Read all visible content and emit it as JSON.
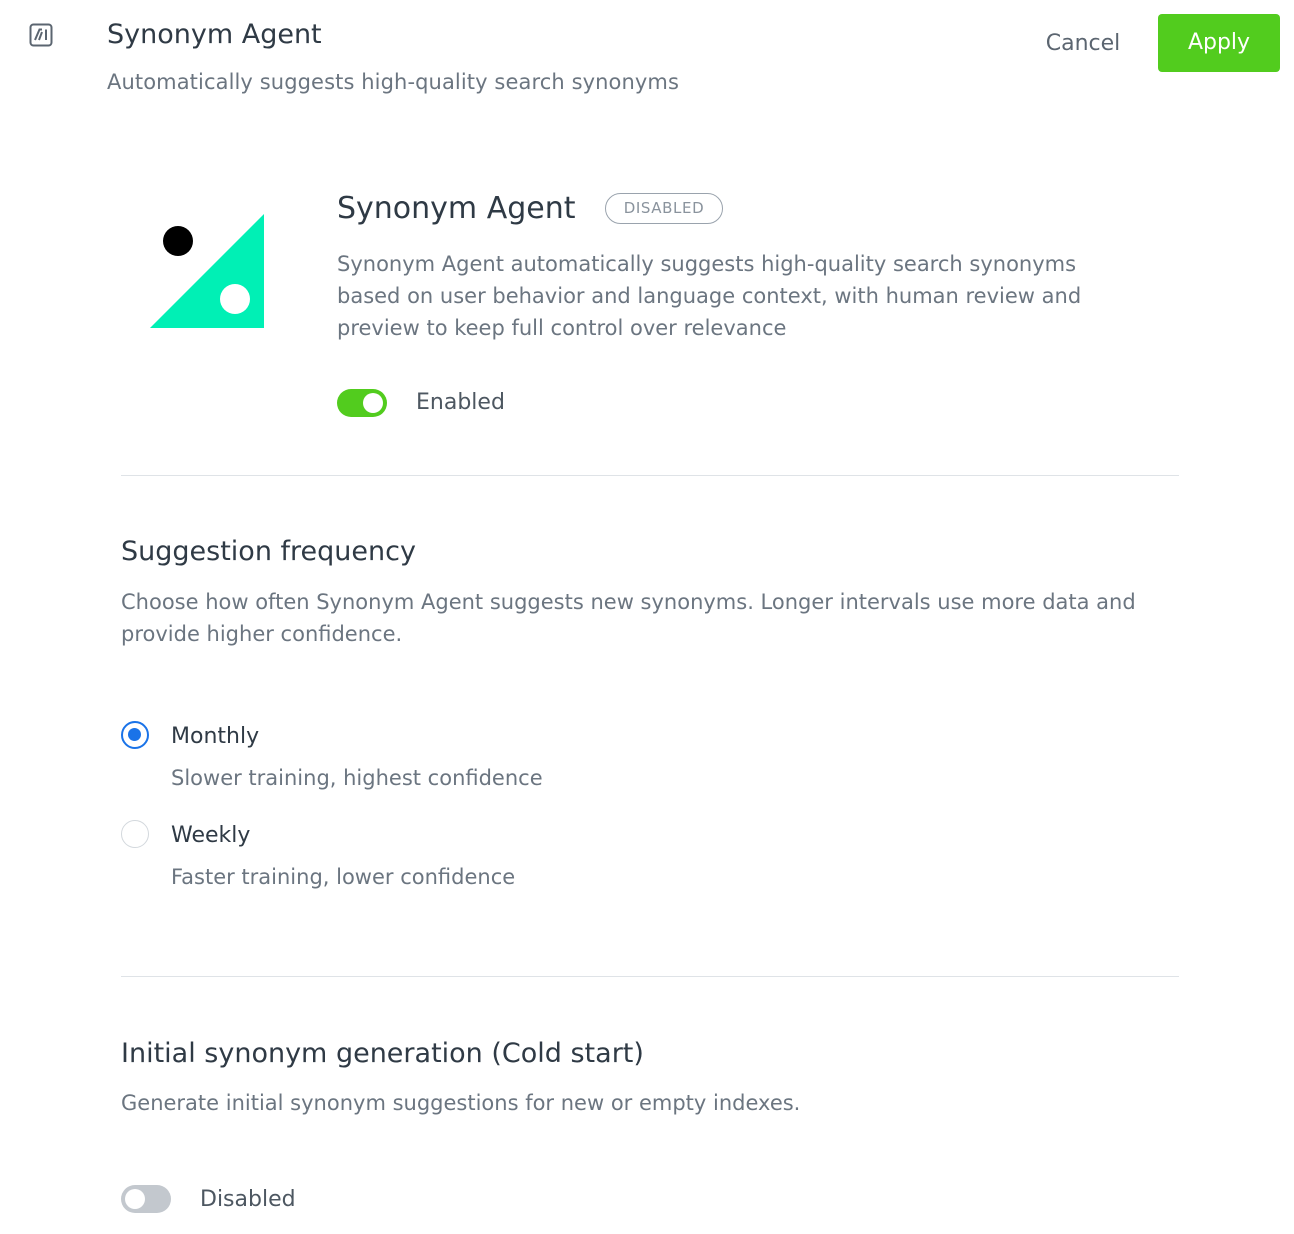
{
  "header": {
    "title": "Synonym Agent",
    "subtitle": "Automatically suggests high-quality search synonyms",
    "icon": "ai-icon",
    "cancel_label": "Cancel",
    "apply_label": "Apply"
  },
  "agent": {
    "name": "Synonym Agent",
    "status_badge": "DISABLED",
    "description": "Synonym Agent automatically suggests high-quality search synonyms based on user behavior and language context, with human review and preview to keep full control over relevance",
    "toggle_on": true,
    "toggle_label": "Enabled",
    "logo": "synonym-agent-logo"
  },
  "frequency": {
    "title": "Suggestion frequency",
    "description": "Choose how often Synonym Agent suggests new synonyms. Longer intervals use more data and provide higher confidence.",
    "selected": "monthly",
    "options": [
      {
        "id": "monthly",
        "label": "Monthly",
        "hint": "Slower training, highest confidence"
      },
      {
        "id": "weekly",
        "label": "Weekly",
        "hint": "Faster training, lower confidence"
      }
    ]
  },
  "cold_start": {
    "title": "Initial synonym generation (Cold start)",
    "description": "Generate initial synonym suggestions for new or empty indexes.",
    "toggle_on": false,
    "toggle_label": "Disabled"
  },
  "colors": {
    "accent_green": "#52cc1e",
    "radio_blue": "#1a73e8",
    "logo_mint": "#00f0b5"
  }
}
